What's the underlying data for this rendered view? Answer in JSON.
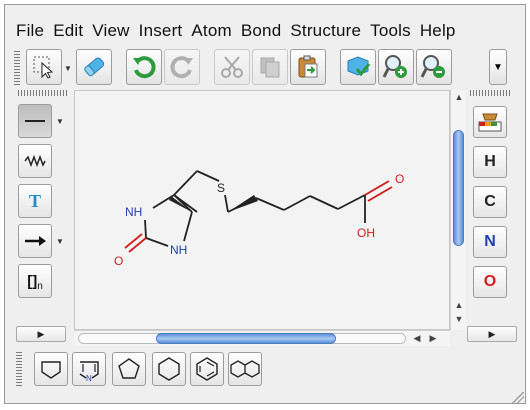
{
  "menu": [
    "File",
    "Edit",
    "View",
    "Insert",
    "Atom",
    "Bond",
    "Structure",
    "Tools",
    "Help"
  ],
  "toolbar_icons": [
    "select-lasso-icon",
    "eraser-icon",
    "undo-icon",
    "redo-icon",
    "cut-icon",
    "copy-icon",
    "paste-icon",
    "clean-structure-icon",
    "zoom-in-icon",
    "zoom-out-icon"
  ],
  "left_palette": {
    "text_tool_label": "T",
    "sgroup_label": "[]",
    "sgroup_subscript": "n"
  },
  "right_palette": {
    "elements": [
      "H",
      "C",
      "N",
      "O"
    ],
    "element_colors": {
      "H": "#222222",
      "C": "#222222",
      "N": "#1f3fb0",
      "O": "#d31c1c"
    }
  },
  "molecule": {
    "atoms": {
      "S": "S",
      "NH_top": "NH",
      "NH_bottom": "NH",
      "O_ring": "O",
      "O_acid": "O",
      "OH": "OH"
    },
    "colors": {
      "S": "#222222",
      "N": "#1f3fb0",
      "O": "#d31c1c",
      "bond": "#222222"
    }
  },
  "templates": [
    "cyclopropane-icon",
    "pyrrole-icon",
    "cyclopentane-icon",
    "cyclohexane-icon",
    "benzene-icon",
    "naphthalene-icon"
  ],
  "template_labels": {
    "pyrrole_n": "N"
  }
}
